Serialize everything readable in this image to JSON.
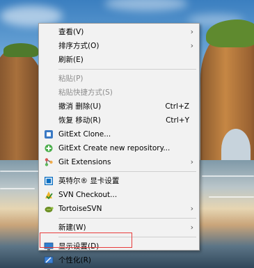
{
  "menu": {
    "items": [
      {
        "label": "查看(V)"
      },
      {
        "label": "排序方式(O)"
      },
      {
        "label": "刷新(E)"
      },
      {
        "label": "粘贴(P)"
      },
      {
        "label": "粘贴快捷方式(S)"
      },
      {
        "label": "撤消 删除(U)",
        "shortcut": "Ctrl+Z"
      },
      {
        "label": "恢复 移动(R)",
        "shortcut": "Ctrl+Y"
      },
      {
        "label": "GitExt Clone..."
      },
      {
        "label": "GitExt Create new repository..."
      },
      {
        "label": "Git Extensions"
      },
      {
        "label": "英特尔® 显卡设置"
      },
      {
        "label": "SVN Checkout..."
      },
      {
        "label": "TortoiseSVN"
      },
      {
        "label": "新建(W)"
      },
      {
        "label": "显示设置(D)"
      },
      {
        "label": "个性化(R)"
      }
    ],
    "icons": {
      "gitext-clone": "gitext-clone-icon",
      "gitext-create": "gitext-create-icon",
      "git-extensions": "git-extensions-icon",
      "intel-graphics": "intel-graphics-icon",
      "svn-checkout": "svn-checkout-icon",
      "tortoisesvn": "tortoisesvn-icon",
      "display-settings": "display-settings-icon",
      "personalize": "personalize-icon"
    },
    "highlight_color": "#e83b3b",
    "disabled_color": "#8d8d8d"
  }
}
